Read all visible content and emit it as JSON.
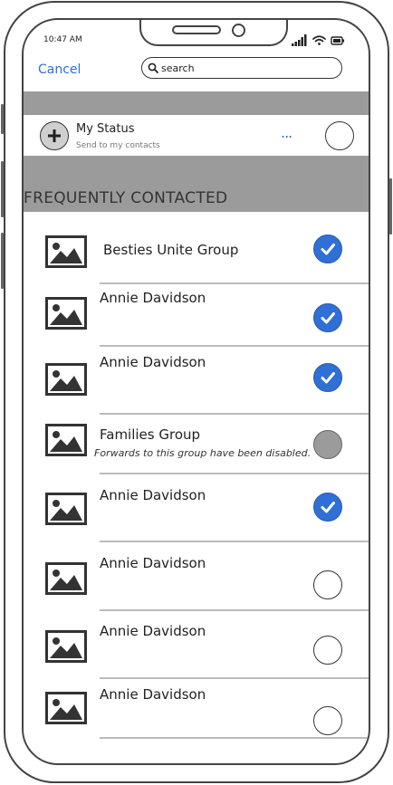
{
  "status_bar": {
    "time": "10:47 AM"
  },
  "header": {
    "cancel_label": "Cancel",
    "search_placeholder": "search"
  },
  "my_status": {
    "title": "My Status",
    "subtitle": "Send to my contacts",
    "more_label": "..."
  },
  "section": {
    "title": "FREQUENTLY CONTACTED"
  },
  "contacts": [
    {
      "name": "Besties Unite Group",
      "subtitle": "",
      "state": "selected"
    },
    {
      "name": "Annie Davidson",
      "subtitle": "",
      "state": "selected"
    },
    {
      "name": "Annie Davidson",
      "subtitle": "",
      "state": "selected"
    },
    {
      "name": "Families Group",
      "subtitle": "Forwards to this group have been disabled.",
      "state": "disabled"
    },
    {
      "name": "Annie Davidson",
      "subtitle": "",
      "state": "selected"
    },
    {
      "name": "Annie Davidson",
      "subtitle": "",
      "state": "unselected"
    },
    {
      "name": "Annie Davidson",
      "subtitle": "",
      "state": "unselected"
    },
    {
      "name": "Annie Davidson",
      "subtitle": "",
      "state": "unselected"
    }
  ],
  "colors": {
    "accent": "#2f6fd6",
    "section_bg": "#9b9b9b"
  },
  "icons": {
    "contact_thumb": "image-placeholder-icon",
    "selected": "checkmark-icon",
    "add": "plus-icon",
    "search": "search-icon"
  }
}
